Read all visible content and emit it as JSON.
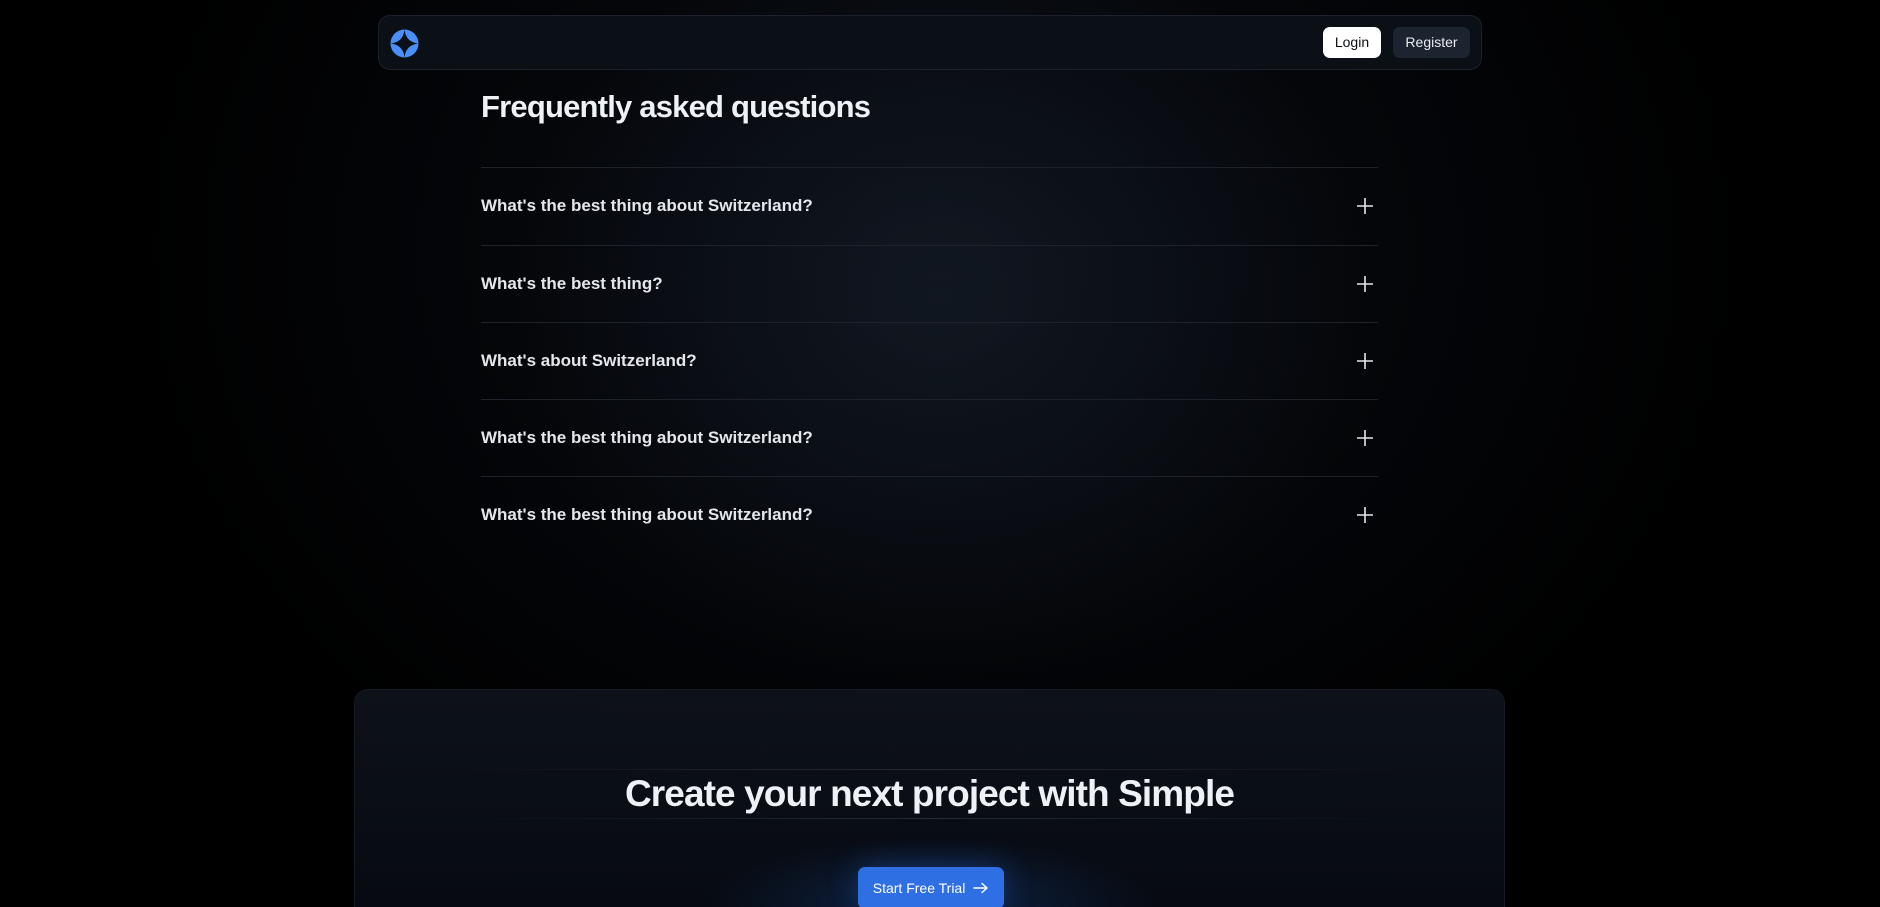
{
  "navbar": {
    "logo_icon": "brand-logo-icon",
    "login_label": "Login",
    "register_label": "Register"
  },
  "faq": {
    "title": "Frequently asked questions",
    "items": [
      {
        "question": "What's the best thing about Switzerland?",
        "icon": "plus-icon"
      },
      {
        "question": "What's the best thing?",
        "icon": "plus-icon"
      },
      {
        "question": "What's about Switzerland?",
        "icon": "plus-icon"
      },
      {
        "question": "What's the best thing about Switzerland?",
        "icon": "plus-icon"
      },
      {
        "question": "What's the best thing about Switzerland?",
        "icon": "plus-icon"
      }
    ]
  },
  "cta": {
    "heading": "Create your next project with Simple",
    "button_label": "Start Free Trial",
    "button_icon": "arrow-right-icon"
  },
  "colors": {
    "background": "#000000",
    "accent": "#2f6fe4",
    "logo": "#3b82f6"
  }
}
